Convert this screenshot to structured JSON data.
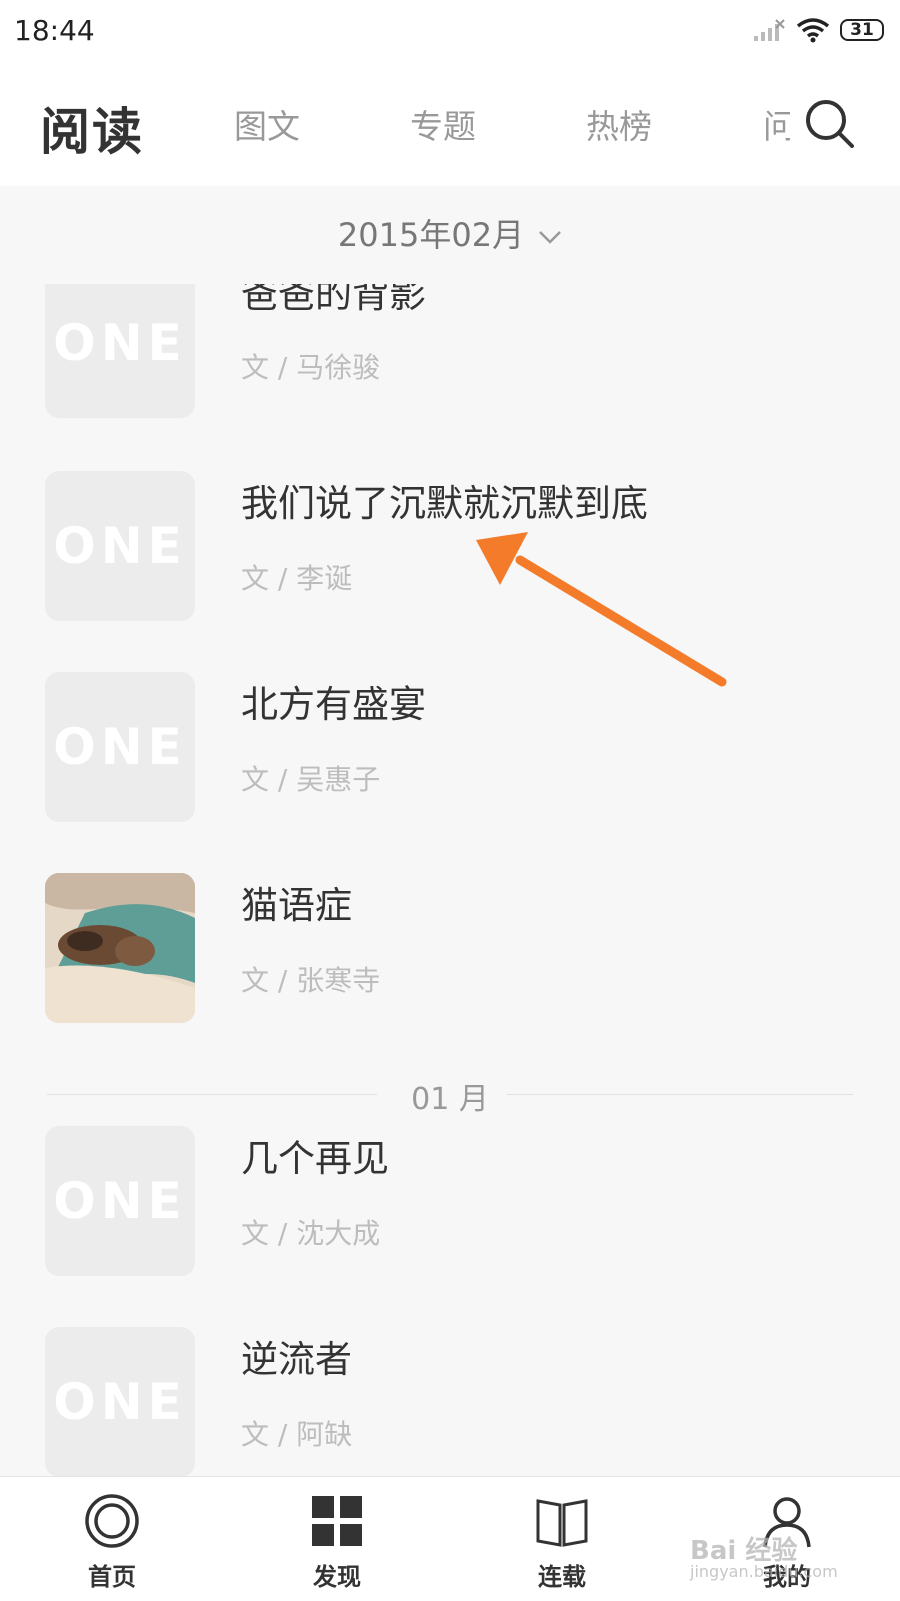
{
  "status_bar": {
    "time": "18:44",
    "battery": "31"
  },
  "header": {
    "title": "阅读",
    "tabs": [
      "图文",
      "专题",
      "热榜",
      "问"
    ]
  },
  "month_selector": "2015年02月",
  "thumb_logo": "ONE",
  "articles": [
    {
      "title": "爸爸的背影",
      "author": "文 / 马徐骏"
    },
    {
      "title": "我们说了沉默就沉默到底",
      "author": "文 / 李诞"
    },
    {
      "title": "北方有盛宴",
      "author": "文 / 吴惠子"
    },
    {
      "title": "猫语症",
      "author": "文 / 张寒寺"
    },
    {
      "title": "几个再见",
      "author": "文 / 沈大成"
    },
    {
      "title": "逆流者",
      "author": "文 / 阿缺"
    }
  ],
  "month_divider": "01 月",
  "bottom_nav": [
    "首页",
    "发现",
    "连载",
    "我的"
  ],
  "accent_color": "#f47b2a",
  "watermark": {
    "main": "Bai 经验",
    "sub": "jingyan.baidu.com"
  }
}
